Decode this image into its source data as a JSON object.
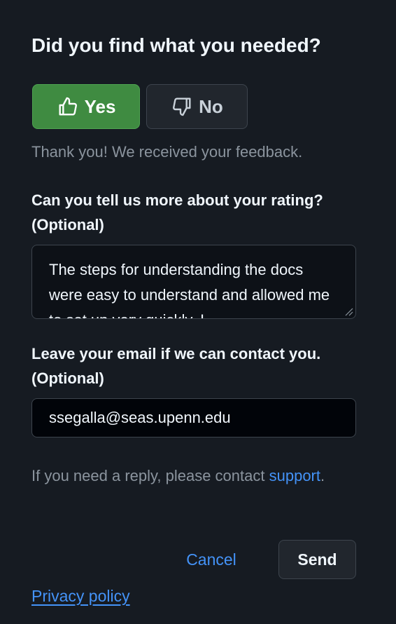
{
  "feedback": {
    "heading": "Did you find what you needed?",
    "yes_label": "Yes",
    "no_label": "No",
    "selected": "Yes",
    "thanks_message": "Thank you! We received your feedback.",
    "more_label_line1": "Can you tell us more about your rating?",
    "more_label_line2": "(Optional)",
    "comment_value": "The steps for understanding the docs were easy to understand and allowed me to set up very quickly. I",
    "email_label_line1": "Leave your email if we can contact you.",
    "email_label_line2": "(Optional)",
    "email_value": "ssegalla@seas.upenn.edu",
    "reply_prefix": "If you need a reply, please contact",
    "support_link": "support",
    "reply_suffix": ".",
    "cancel_label": "Cancel",
    "send_label": "Send",
    "privacy_link": "Privacy policy"
  },
  "icons": {
    "yes_icon": "thumbs-up-icon",
    "no_icon": "thumbs-down-icon",
    "resize_icon": "resize-grip-icon"
  },
  "colors": {
    "background": "#161b22",
    "yes_button": "#3f8b41",
    "secondary_button": "#21262d",
    "link": "#4493f8",
    "muted_text": "#8b949e",
    "input_background": "#0d1117"
  }
}
